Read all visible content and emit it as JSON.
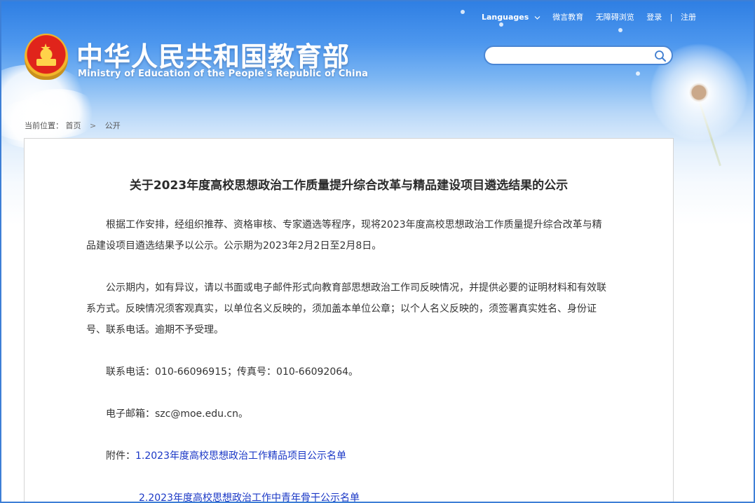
{
  "header": {
    "brand_cn": "中华人民共和国教育部",
    "brand_en": "Ministry of Education of the People's Republic of China",
    "topnav": {
      "languages": "Languages",
      "weiyan": "微言教育",
      "accessibility": "无障碍浏览",
      "login": "登录",
      "separator": "|",
      "register": "注册"
    },
    "search": {
      "value": "",
      "placeholder": ""
    }
  },
  "breadcrumb": {
    "prefix": "当前位置：",
    "items": [
      "首页",
      "公开"
    ],
    "arrow": ">"
  },
  "article": {
    "title": "关于2023年度高校思想政治工作质量提升综合改革与精品建设项目遴选结果的公示",
    "paragraphs": [
      "根据工作安排，经组织推荐、资格审核、专家遴选等程序，现将2023年度高校思想政治工作质量提升综合改革与精品建设项目遴选结果予以公示。公示期为2023年2月2日至2月8日。",
      "公示期内，如有异议，请以书面或电子邮件形式向教育部思想政治工作司反映情况，并提供必要的证明材料和有效联系方式。反映情况须客观真实，以单位名义反映的，须加盖本单位公章；以个人名义反映的，须签署真实姓名、身份证号、联系电话。逾期不予受理。",
      "联系电话：010-66096915；传真号：010-66092064。",
      "电子邮箱：szc@moe.edu.cn。"
    ],
    "attachments_label": "附件：",
    "attachments": [
      "1.2023年度高校思想政治工作精品项目公示名单",
      "2.2023年度高校思想政治工作中青年骨干公示名单"
    ]
  },
  "colors": {
    "header_blue": "#2f7fe3",
    "frame_border": "#3d7fd6",
    "link": "#1a37c6",
    "emblem_red": "#e0241b",
    "emblem_gold": "#ffd34a"
  }
}
